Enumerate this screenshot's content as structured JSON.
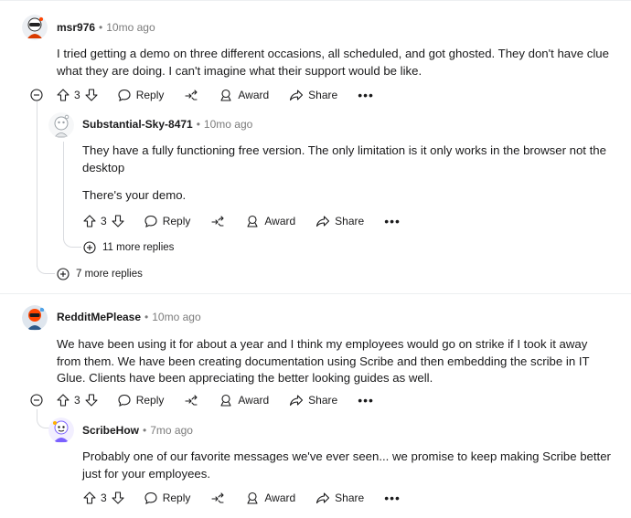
{
  "comments": [
    {
      "username": "msr976",
      "age": "10mo ago",
      "body": [
        "I tried getting a demo on three different occasions, all scheduled, and got ghosted. They don't have clue what they are doing. I can't imagine what their support would be like."
      ],
      "votes": "3",
      "reply_label": "Reply",
      "award_label": "Award",
      "share_label": "Share",
      "more_replies": "7 more replies"
    },
    {
      "username": "Substantial-Sky-8471",
      "age": "10mo ago",
      "body": [
        "They have a fully functioning free version. The only limitation is it only works in the browser not the desktop",
        "There's your demo."
      ],
      "votes": "3",
      "reply_label": "Reply",
      "award_label": "Award",
      "share_label": "Share",
      "more_replies": "11 more replies"
    },
    {
      "username": "RedditMePlease",
      "age": "10mo ago",
      "body": [
        "We have been using it for about a year and I think my employees would go on strike if I took it away from them. We have been creating documentation using Scribe and then embedding the scribe in IT Glue. Clients have been appreciating the better looking guides as well."
      ],
      "votes": "3",
      "reply_label": "Reply",
      "award_label": "Award",
      "share_label": "Share"
    },
    {
      "username": "ScribeHow",
      "age": "7mo ago",
      "body": [
        "Probably one of our favorite messages we've ever seen... we promise to keep making Scribe better just for your employees."
      ],
      "votes": "3",
      "reply_label": "Reply",
      "award_label": "Award",
      "share_label": "Share"
    }
  ],
  "separator": "•",
  "more_glyph": "•••",
  "icons": {
    "upvote": "arrow-up-icon",
    "downvote": "arrow-down-icon",
    "reply": "speech-bubble-icon",
    "award": "award-icon",
    "share": "share-arrow-icon",
    "collapse": "minus-circle-icon",
    "expand": "plus-circle-icon",
    "repost": "repost-icon"
  }
}
